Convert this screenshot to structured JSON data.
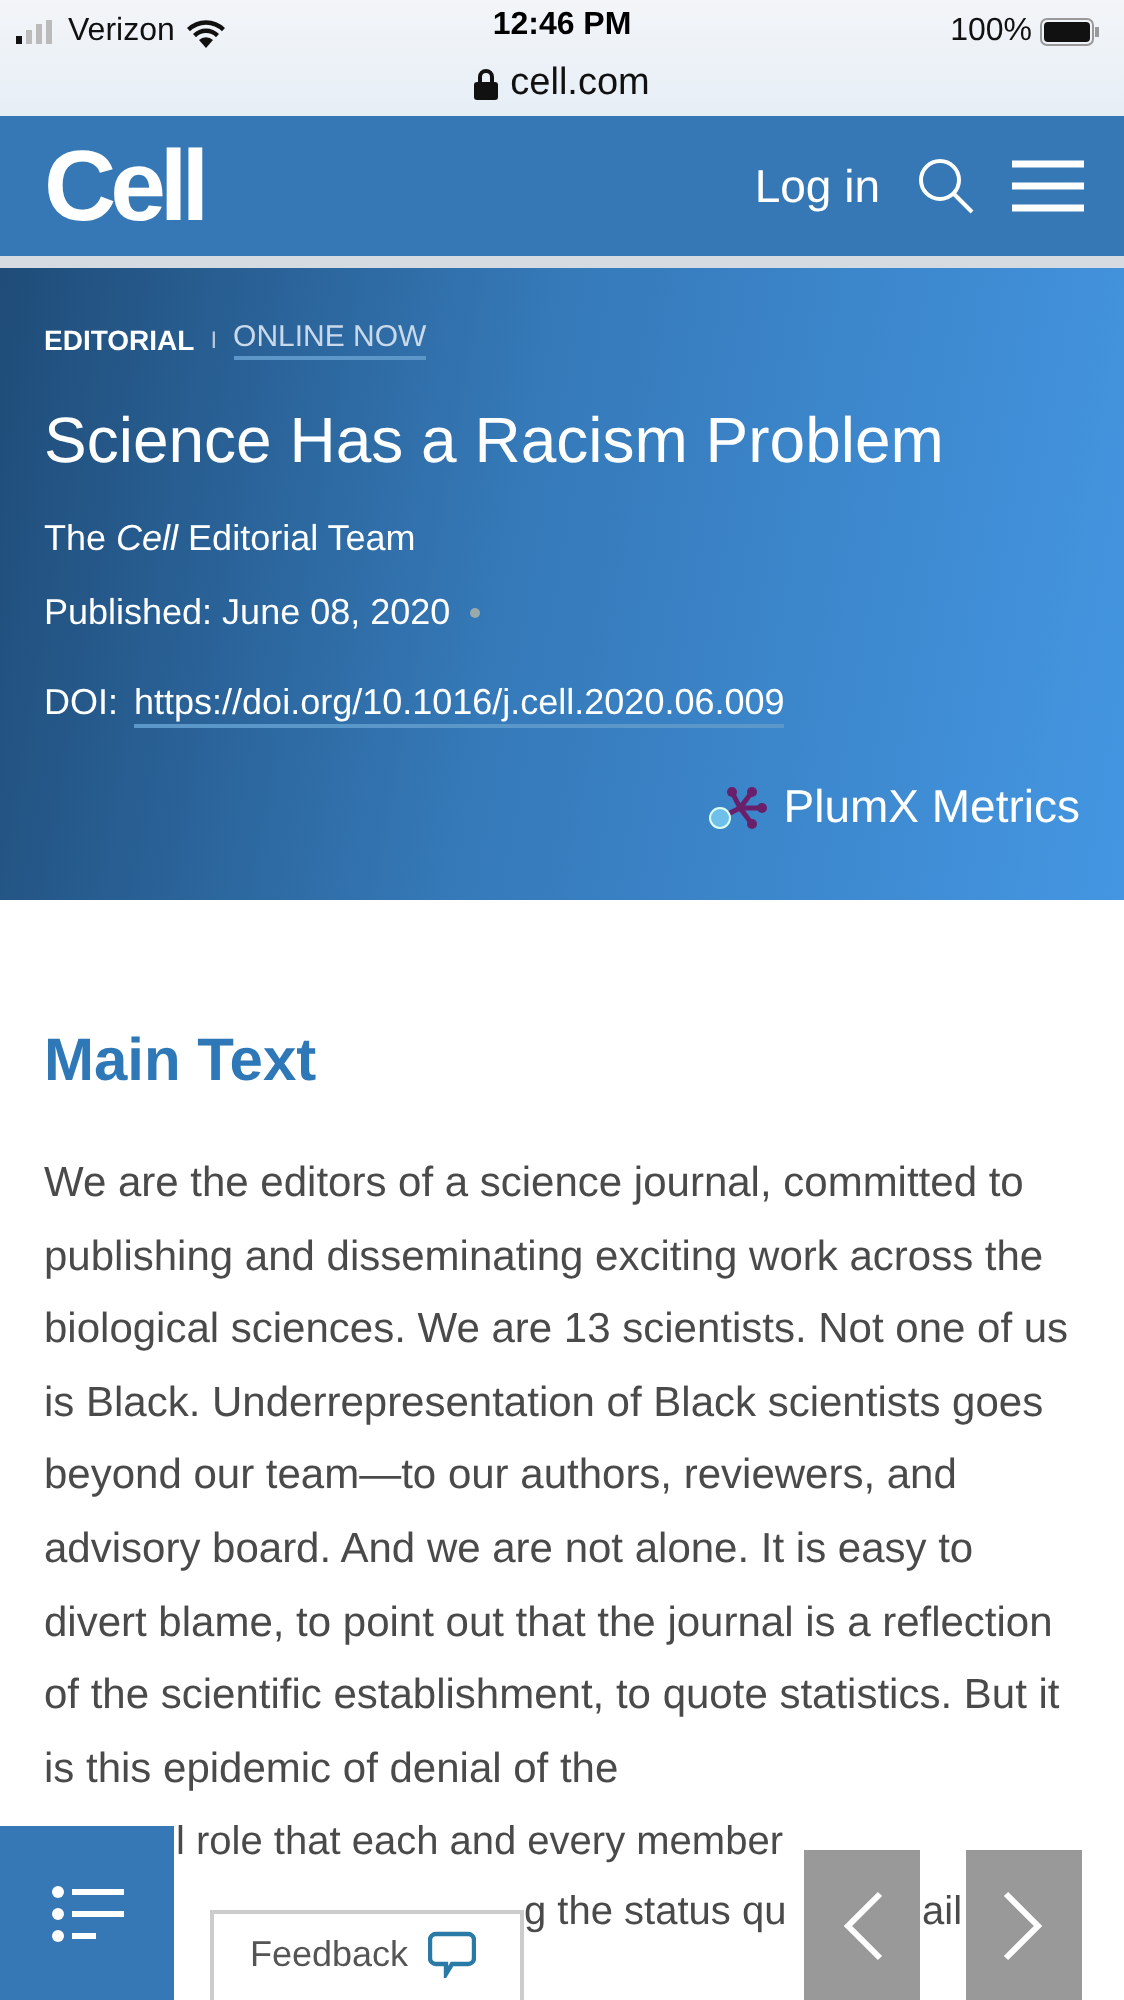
{
  "status_bar": {
    "carrier": "Verizon",
    "time": "12:46 PM",
    "battery": "100%"
  },
  "address_bar": {
    "url": "cell.com"
  },
  "header": {
    "logo": "Cell",
    "login": "Log in"
  },
  "article": {
    "type": "EDITORIAL",
    "separator": "I",
    "status": "ONLINE NOW",
    "title": "Science Has a Racism Problem",
    "authors": "The *Cell* Editorial Team",
    "published": "Published: June 08, 2020",
    "doi_label": "DOI:",
    "doi": "https://doi.org/10.1016/j.cell.2020.06.009",
    "metrics": "PlumX Metrics"
  },
  "main_text": {
    "heading": "Main Text",
    "paragraph": "We are the editors of a science journal, committed to publishing and disseminating exciting work across the biological sciences. We are 13 scientists. Not one of us is Black. Underrepresentation of Black scientists goes beyond our team—to our authors, reviewers, and advisory board. And we are not alone. It is easy to divert blame, to point out that the journal is a reflection of the scientific establishment, to quote statistics. But it is this epidemic of denial of the",
    "fragments": [
      "l role that each and every member",
      "g the status qu",
      "ail"
    ]
  },
  "feedback": {
    "label": "Feedback"
  }
}
